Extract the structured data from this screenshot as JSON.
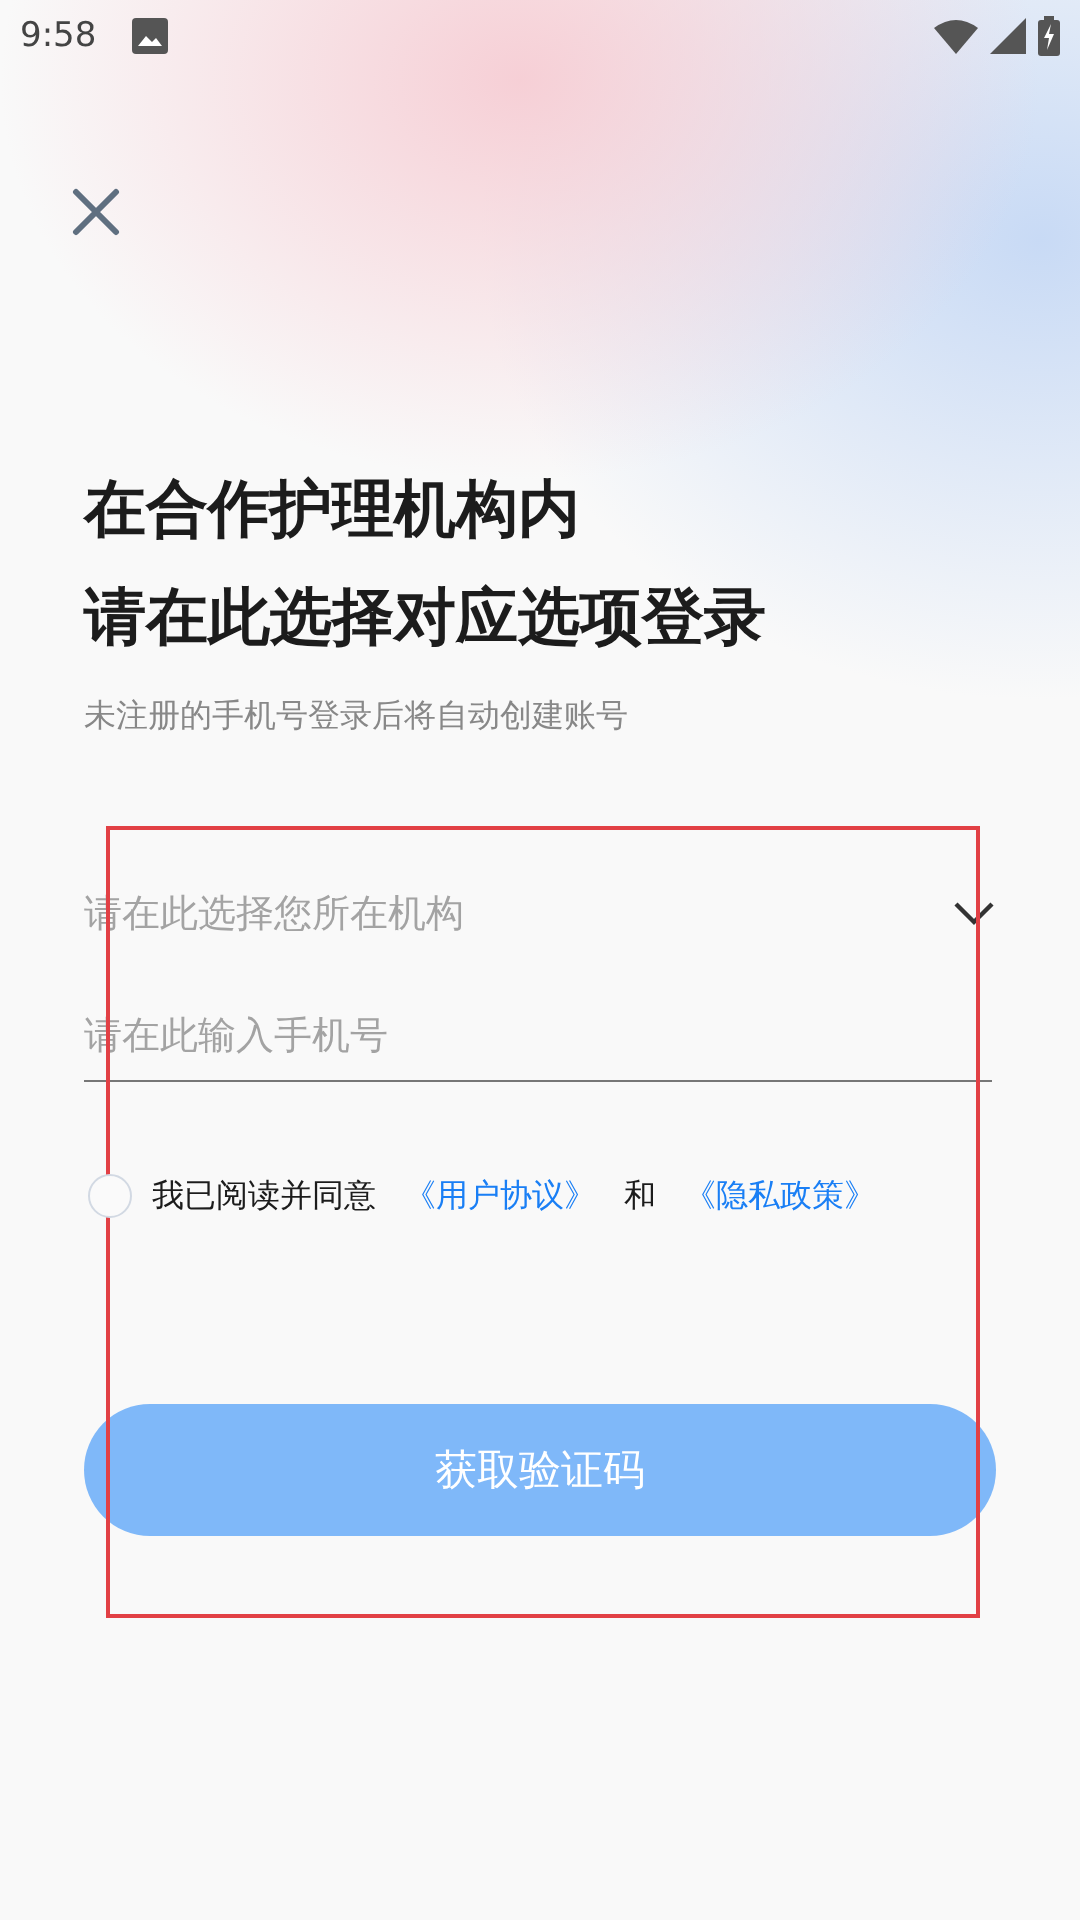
{
  "status_bar": {
    "time": "9:58"
  },
  "title_lines": [
    "在合作护理机构内",
    "请在此选择对应选项登录"
  ],
  "subtitle": "未注册的手机号登录后将自动创建账号",
  "institution_select": {
    "placeholder": "请在此选择您所在机构"
  },
  "phone_field": {
    "placeholder": "请在此输入手机号"
  },
  "agreement": {
    "checked": false,
    "prefix": "我已阅读并同意",
    "user_agreement": "《用户协议》",
    "conjunction": "和",
    "privacy_policy": "《隐私政策》"
  },
  "submit_button": {
    "label": "获取验证码",
    "disabled": true
  }
}
